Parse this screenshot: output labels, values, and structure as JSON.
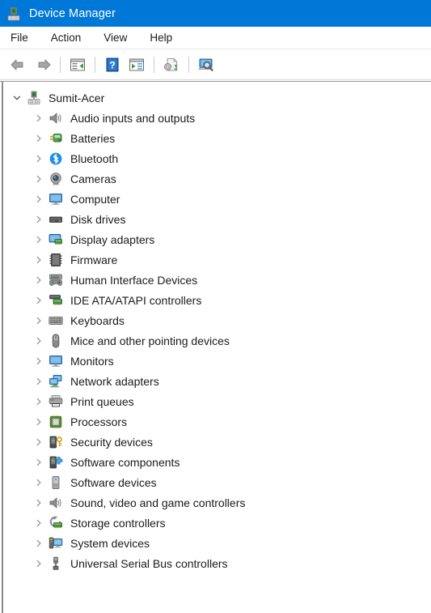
{
  "window": {
    "title": "Device Manager",
    "title_icon": "device-manager-icon",
    "titlebar_color": "#0078d7",
    "titlebar_text_color": "#ffffff",
    "background_color": "#ffffff",
    "text_color": "#1b1b1b"
  },
  "menubar": {
    "items": [
      {
        "label": "File",
        "name": "menu-file"
      },
      {
        "label": "Action",
        "name": "menu-action"
      },
      {
        "label": "View",
        "name": "menu-view"
      },
      {
        "label": "Help",
        "name": "menu-help"
      }
    ]
  },
  "toolbar": {
    "buttons": [
      {
        "icon": "back-arrow-icon",
        "name": "toolbar-back"
      },
      {
        "icon": "forward-arrow-icon",
        "name": "toolbar-forward"
      },
      {
        "icon": "separator",
        "name": "toolbar-separator-1"
      },
      {
        "icon": "show-properties-icon",
        "name": "toolbar-properties"
      },
      {
        "icon": "separator",
        "name": "toolbar-separator-2"
      },
      {
        "icon": "help-icon",
        "name": "toolbar-help"
      },
      {
        "icon": "show-hidden-devices-icon",
        "name": "toolbar-show-hidden"
      },
      {
        "icon": "separator",
        "name": "toolbar-separator-3"
      },
      {
        "icon": "update-driver-icon",
        "name": "toolbar-update-driver"
      },
      {
        "icon": "separator",
        "name": "toolbar-separator-4"
      },
      {
        "icon": "scan-hardware-changes-icon",
        "name": "toolbar-scan-hardware"
      }
    ]
  },
  "tree": {
    "root": {
      "label": "Sumit-Acer",
      "icon": "computer-device-icon",
      "expanded": true,
      "twisty": "chevron-down-icon"
    },
    "children": [
      {
        "label": "Audio inputs and outputs",
        "icon": "speaker-icon",
        "expanded": false
      },
      {
        "label": "Batteries",
        "icon": "battery-icon",
        "expanded": false
      },
      {
        "label": "Bluetooth",
        "icon": "bluetooth-icon",
        "expanded": false
      },
      {
        "label": "Cameras",
        "icon": "camera-icon",
        "expanded": false
      },
      {
        "label": "Computer",
        "icon": "monitor-icon",
        "expanded": false
      },
      {
        "label": "Disk drives",
        "icon": "disk-drive-icon",
        "expanded": false
      },
      {
        "label": "Display adapters",
        "icon": "display-adapter-icon",
        "expanded": false
      },
      {
        "label": "Firmware",
        "icon": "firmware-chip-icon",
        "expanded": false
      },
      {
        "label": "Human Interface Devices",
        "icon": "hid-gamepad-icon",
        "expanded": false
      },
      {
        "label": "IDE ATA/ATAPI controllers",
        "icon": "ide-controller-icon",
        "expanded": false
      },
      {
        "label": "Keyboards",
        "icon": "keyboard-icon",
        "expanded": false
      },
      {
        "label": "Mice and other pointing devices",
        "icon": "mouse-icon",
        "expanded": false
      },
      {
        "label": "Monitors",
        "icon": "monitor-icon",
        "expanded": false
      },
      {
        "label": "Network adapters",
        "icon": "network-adapter-icon",
        "expanded": false
      },
      {
        "label": "Print queues",
        "icon": "printer-icon",
        "expanded": false
      },
      {
        "label": "Processors",
        "icon": "processor-icon",
        "expanded": false
      },
      {
        "label": "Security devices",
        "icon": "security-device-icon",
        "expanded": false
      },
      {
        "label": "Software components",
        "icon": "software-component-icon",
        "expanded": false
      },
      {
        "label": "Software devices",
        "icon": "software-device-icon",
        "expanded": false
      },
      {
        "label": "Sound, video and game controllers",
        "icon": "speaker-icon",
        "expanded": false
      },
      {
        "label": "Storage controllers",
        "icon": "storage-controller-icon",
        "expanded": false
      },
      {
        "label": "System devices",
        "icon": "system-device-icon",
        "expanded": false
      },
      {
        "label": "Universal Serial Bus controllers",
        "icon": "usb-icon",
        "expanded": false
      }
    ]
  }
}
